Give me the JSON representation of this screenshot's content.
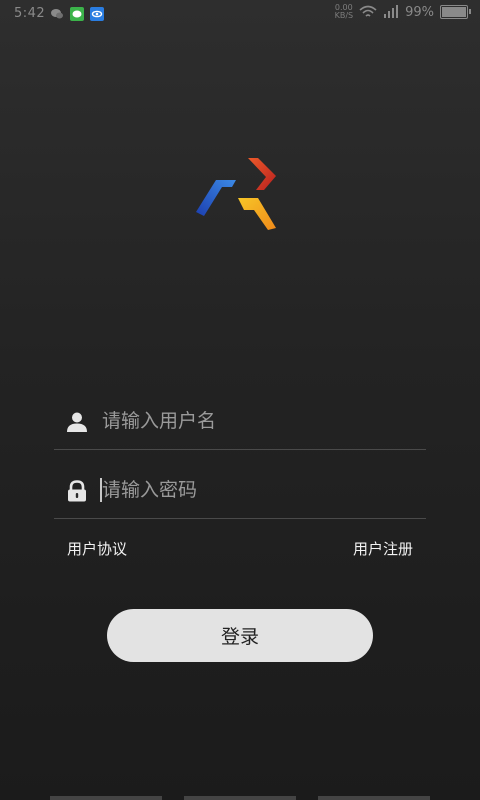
{
  "status_bar": {
    "time": "5:42",
    "speed_top": "0.00",
    "speed_bottom": "KB/S",
    "battery_text": "99%",
    "battery_level": 0.99
  },
  "logo": {
    "colors": {
      "blue": "#2f6bd4",
      "red": "#d8352a",
      "yellow": "#f5b51f"
    }
  },
  "login_form": {
    "username_placeholder": "请输入用户名",
    "password_placeholder": "请输入密码",
    "user_agreement": "用户协议",
    "register": "用户注册",
    "login_button": "登录"
  }
}
